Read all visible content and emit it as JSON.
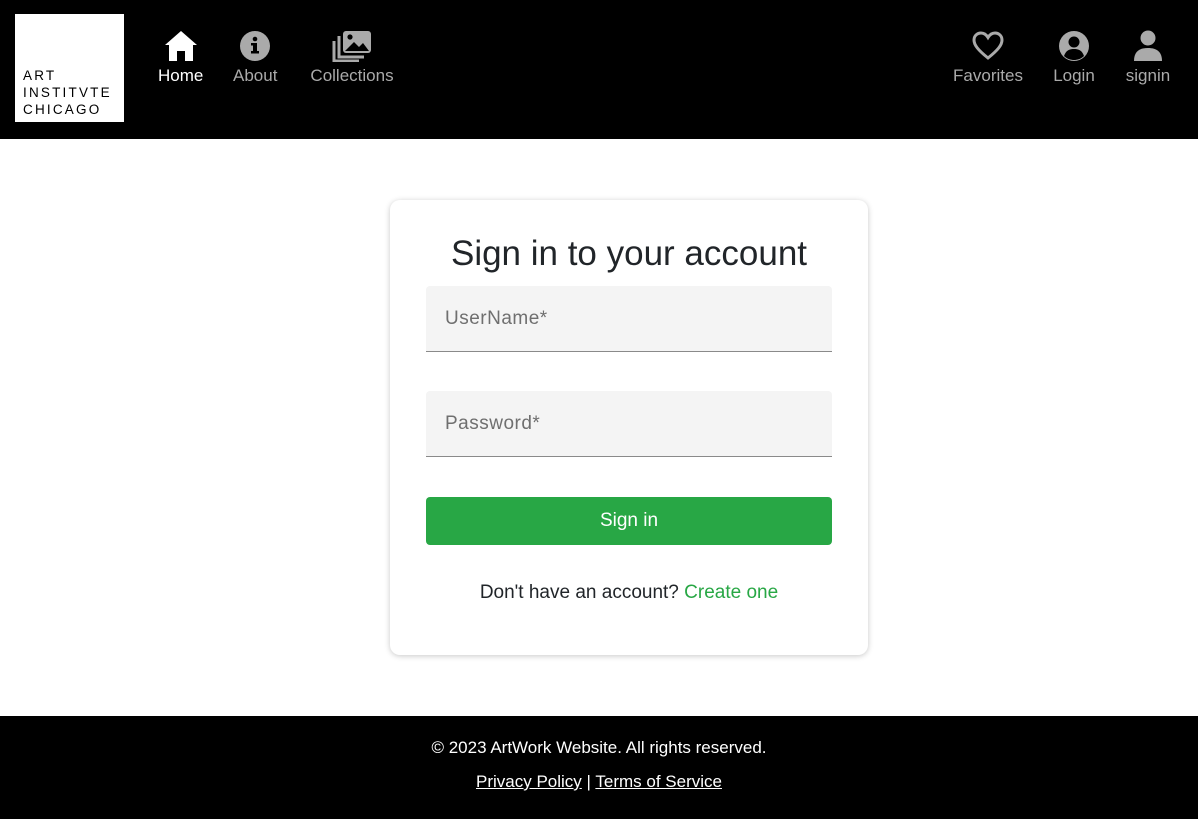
{
  "logo": {
    "lines": [
      "ART",
      "INSTITVTE",
      "CHICAGO"
    ]
  },
  "nav_left": [
    {
      "label": "Home",
      "icon": "home-icon",
      "active": true
    },
    {
      "label": "About",
      "icon": "info-icon",
      "active": false
    },
    {
      "label": "Collections",
      "icon": "images-icon",
      "active": false
    }
  ],
  "nav_right": [
    {
      "label": "Favorites",
      "icon": "heart-icon"
    },
    {
      "label": "Login",
      "icon": "user-circle-icon"
    },
    {
      "label": "signin",
      "icon": "user-icon"
    }
  ],
  "colors": {
    "header_bg": "#000000",
    "nav_inactive": "#aaaaaa",
    "nav_active": "#ffffff",
    "accent_green": "#28a745",
    "field_bg": "#f4f4f4"
  },
  "form": {
    "title": "Sign in to your account",
    "username_placeholder": "UserName*",
    "username_value": "",
    "password_placeholder": "Password*",
    "password_value": "",
    "submit_label": "Sign in",
    "signup_prompt": "Don't have an account?",
    "signup_link": "Create one"
  },
  "footer": {
    "copyright": "© 2023 ArtWork Website. All rights reserved.",
    "privacy_label": "Privacy Policy",
    "separator": "|",
    "terms_label": "Terms of Service"
  }
}
